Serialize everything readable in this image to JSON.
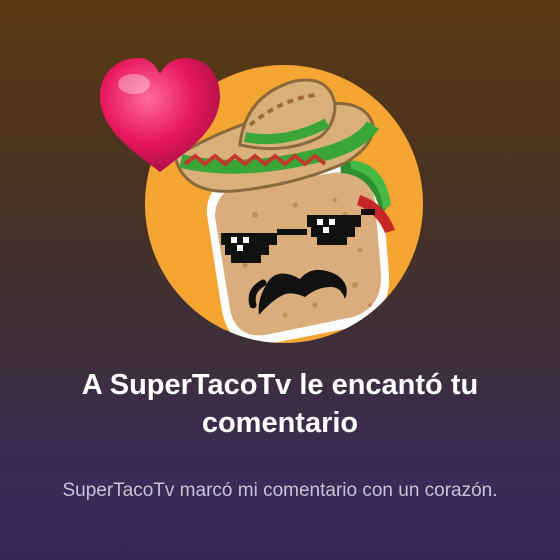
{
  "notification": {
    "title": "A SuperTacoTv le encantó tu comentario",
    "message": "SuperTacoTv marcó mi comentario con un corazón."
  },
  "avatar": {
    "icon": "taco-mascot-with-sombrero-icon",
    "background_color": "#f5a531"
  },
  "reaction": {
    "icon": "heart-icon",
    "color": "#e8175d"
  },
  "colors": {
    "background_top": "#5c3a12",
    "background_bottom": "#362757",
    "title_text": "#ffffff",
    "message_text": "#c9c3d6"
  }
}
